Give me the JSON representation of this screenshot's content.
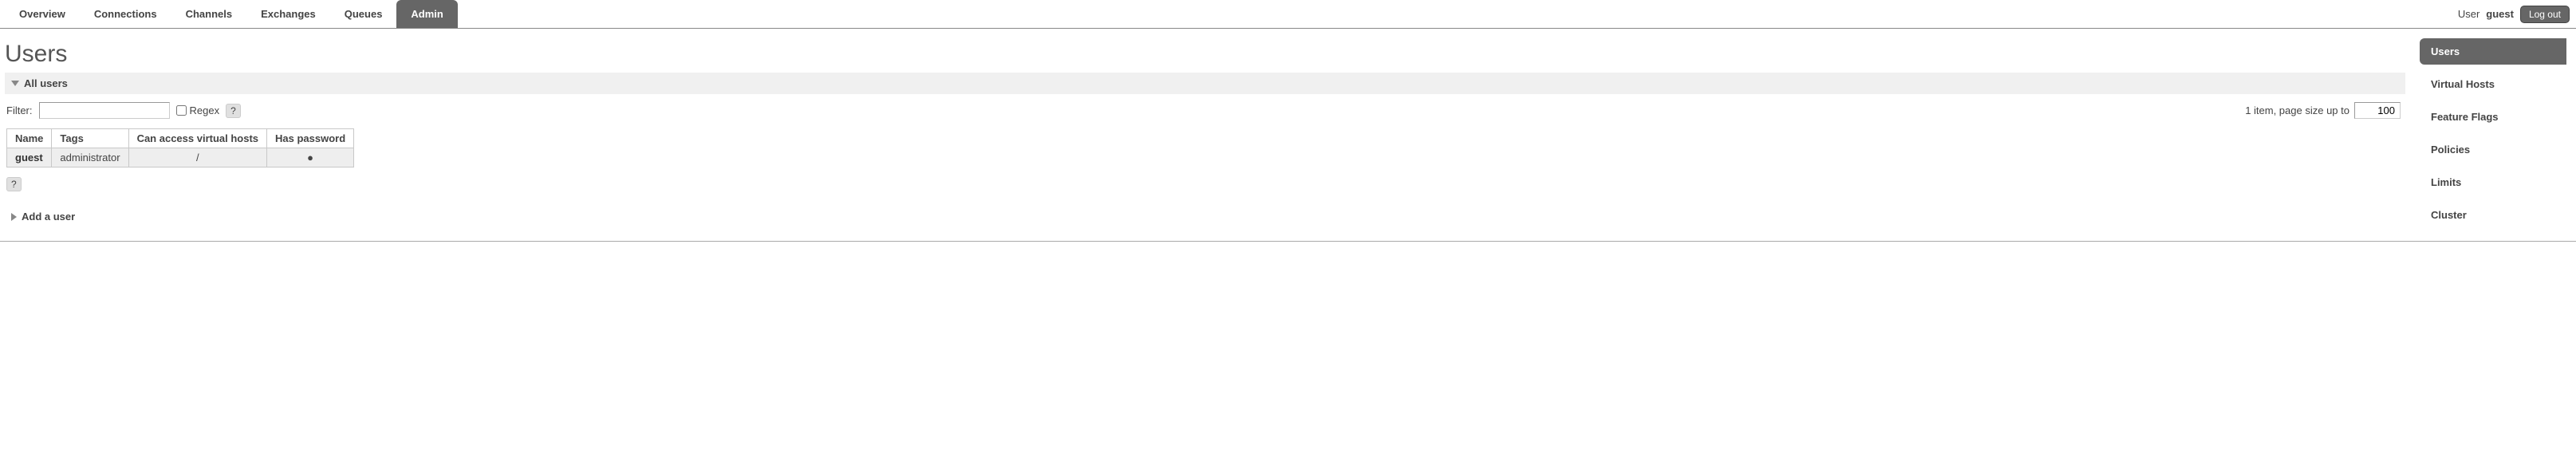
{
  "nav": {
    "tabs": [
      {
        "label": "Overview"
      },
      {
        "label": "Connections"
      },
      {
        "label": "Channels"
      },
      {
        "label": "Exchanges"
      },
      {
        "label": "Queues"
      },
      {
        "label": "Admin"
      }
    ],
    "active_index": 5,
    "user_prefix": "User",
    "username": "guest",
    "logout_label": "Log out"
  },
  "page": {
    "title": "Users"
  },
  "sections": {
    "all_users_label": "All users",
    "add_user_label": "Add a user"
  },
  "filter": {
    "label": "Filter:",
    "value": "",
    "regex_label": "Regex",
    "help_symbol": "?",
    "count_text": "1 item, page size up to",
    "page_size": "100"
  },
  "table": {
    "headers": {
      "name": "Name",
      "tags": "Tags",
      "vhosts": "Can access virtual hosts",
      "password": "Has password"
    },
    "rows": [
      {
        "name": "guest",
        "tags": "administrator",
        "vhosts": "/",
        "password": "●"
      }
    ]
  },
  "below_help": "?",
  "sidebar": {
    "items": [
      {
        "label": "Users"
      },
      {
        "label": "Virtual Hosts"
      },
      {
        "label": "Feature Flags"
      },
      {
        "label": "Policies"
      },
      {
        "label": "Limits"
      },
      {
        "label": "Cluster"
      }
    ],
    "active_index": 0
  }
}
